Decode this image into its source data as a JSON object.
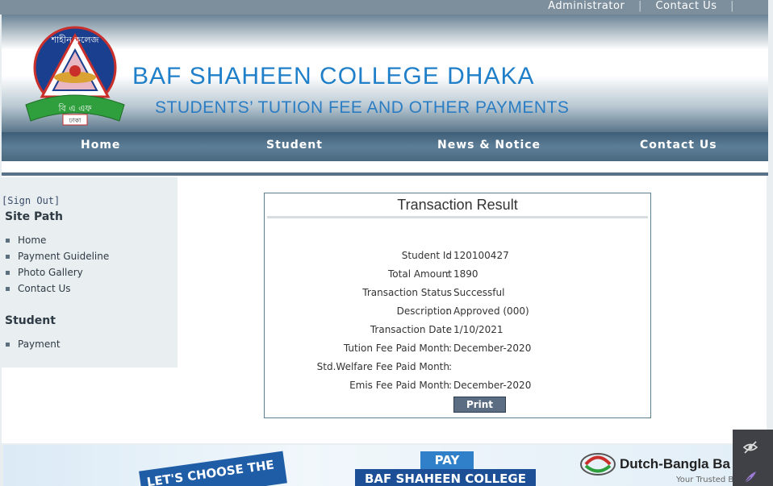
{
  "topbar": {
    "admin": "Administrator",
    "separator": "|",
    "contact": "Contact Us"
  },
  "header": {
    "logo_text_top": "শাহীন কলেজ",
    "logo_text_bottom": "বি এ এফ",
    "logo_text_city": "ঢাকা",
    "title": "BAF SHAHEEN COLLEGE DHAKA",
    "subtitle": "STUDENTS’ TUTION FEE AND OTHER PAYMENTS"
  },
  "nav": {
    "home": "Home",
    "student": "Student",
    "news": "News & Notice",
    "contact": "Contact Us"
  },
  "sidebar": {
    "signout": "[Sign Out]",
    "site_path_heading": "Site Path",
    "site_path_items": [
      "Home",
      "Payment Guideline",
      "Photo Gallery",
      "Contact Us"
    ],
    "student_heading": "Student",
    "student_items": [
      "Payment"
    ]
  },
  "transaction": {
    "title": "Transaction Result",
    "rows": [
      {
        "label": "Student Id",
        "value": "120100427"
      },
      {
        "label": "Total Amount",
        "value": "1890"
      },
      {
        "label": "Transaction Status",
        "value": "Successful"
      },
      {
        "label": "Description",
        "value": "Approved (000)"
      },
      {
        "label": "Transaction Date",
        "value": "1/10/2021"
      },
      {
        "label": "Tution Fee Paid Month",
        "value": "December-2020"
      },
      {
        "label": "Std.Welfare Fee Paid Month",
        "value": ""
      },
      {
        "label": "Emis Fee Paid Month",
        "value": "December-2020"
      }
    ],
    "print_label": "Print"
  },
  "banner": {
    "tag": "LET'S CHOOSE THE",
    "pay": "PAY",
    "college": "BAF SHAHEEN COLLEGE",
    "bank": "Dutch-Bangla Ba",
    "bank_tagline": "Your Trusted B"
  },
  "colors": {
    "title_blue": "#1f7fc8",
    "nav_bg": "#4a6a82",
    "panel_border": "#5c7e8e",
    "button_bg": "#5b6d82"
  }
}
